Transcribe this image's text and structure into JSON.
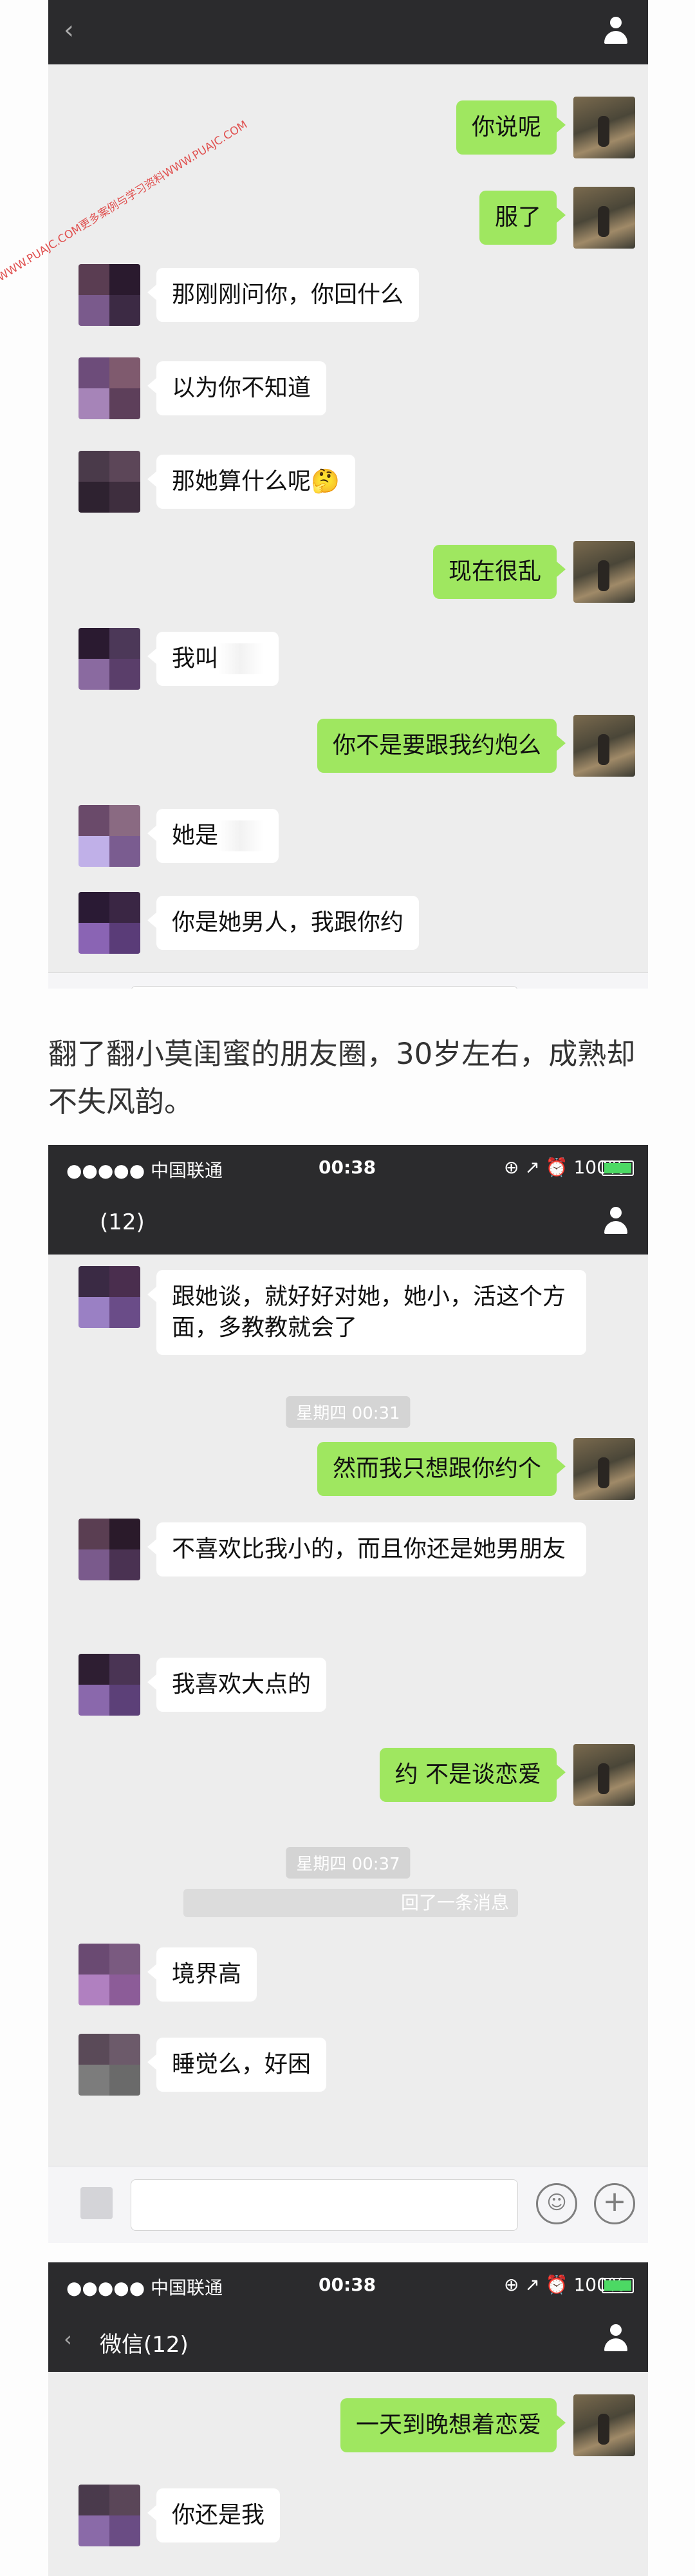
{
  "watermark": "WWW.PUAJC.COM更多案例与学习资料WWW.PUAJC.COM",
  "caption": "翻了翻小莫闺蜜的朋友圈，30岁左右，成熟却不失风韵。",
  "status_bar": {
    "carrier": "●●●●● 中国联通",
    "time": "00:38",
    "right": "⊕ ↗ ⏰ 100%"
  },
  "screen1": {
    "messages": [
      {
        "side": "out",
        "text": "你说呢"
      },
      {
        "side": "out",
        "text": "服了"
      },
      {
        "side": "in",
        "text": "那刚刚问你，你回什么"
      },
      {
        "side": "in",
        "text": "以为你不知道"
      },
      {
        "side": "in",
        "text": "那她算什么呢🤔"
      },
      {
        "side": "out",
        "text": "现在很乱"
      },
      {
        "side": "in",
        "text": "我叫"
      },
      {
        "side": "out",
        "text": "你不是要跟我约炮么"
      },
      {
        "side": "in",
        "text": "她是"
      },
      {
        "side": "in",
        "text": "你是她男人，我跟你约"
      }
    ]
  },
  "screen2": {
    "title": "(12)",
    "messages": [
      {
        "side": "in",
        "text": "跟她谈，就好好对她，她小，活这个方面，多教教就会了"
      },
      {
        "side": "out",
        "text": "然而我只想跟你约个"
      },
      {
        "side": "in",
        "text": "不喜欢比我小的，而且你还是她男朋友"
      },
      {
        "side": "in",
        "text": "我喜欢大点的"
      },
      {
        "side": "out",
        "text": "约   不是谈恋爱"
      },
      {
        "side": "in",
        "text": "境界高"
      },
      {
        "side": "in",
        "text": "睡觉么，好困"
      }
    ],
    "timestamps": [
      "星期四 00:31",
      "星期四 00:37"
    ],
    "recall_text": "回了一条消息"
  },
  "screen3": {
    "back_label": "微信(12)",
    "messages": [
      {
        "side": "out",
        "text": "一天到晚想着恋爱"
      },
      {
        "side": "in",
        "text": "你还是我"
      }
    ]
  },
  "icons": {
    "emoji": "☺",
    "plus": "+"
  },
  "colors": {
    "outgoing_bubble": "#9fe760",
    "incoming_bubble": "#ffffff",
    "chat_bg": "#ededed",
    "titlebar": "#2b2b2d"
  }
}
